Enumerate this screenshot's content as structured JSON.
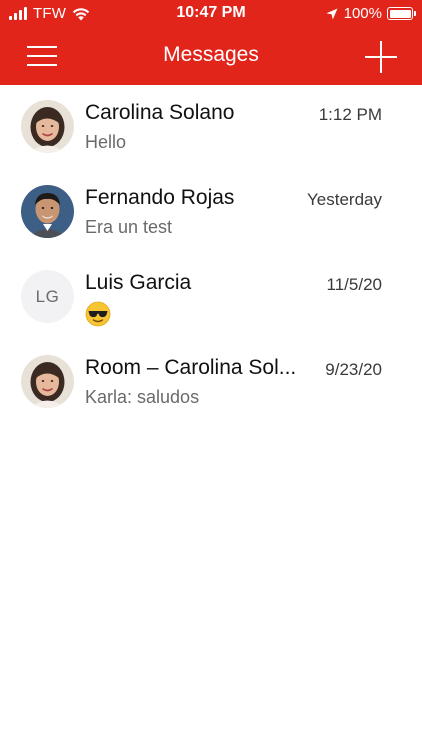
{
  "status_bar": {
    "carrier": "TFW",
    "time": "10:47 PM",
    "battery_percent": "100%",
    "signal_bars": 4,
    "battery_level": 1.0
  },
  "nav": {
    "title": "Messages",
    "menu_icon": "hamburger-menu-icon",
    "add_icon": "plus-icon"
  },
  "colors": {
    "header_bg": "#e1251b",
    "header_text": "#ffffff"
  },
  "conversations": [
    {
      "name": "Carolina Solano",
      "time": "1:12 PM",
      "preview": "Hello",
      "avatar": "photo"
    },
    {
      "name": "Fernando Rojas",
      "time": "Yesterday",
      "preview": "Era un test",
      "avatar": "photo"
    },
    {
      "name": "Luis Garcia",
      "time": "11/5/20",
      "preview_icon": "sunglasses-emoji",
      "avatar_initials": "LG"
    },
    {
      "name": "Room – Carolina Sol...",
      "time": "9/23/20",
      "preview": "Karla: saludos",
      "avatar": "photo"
    }
  ]
}
